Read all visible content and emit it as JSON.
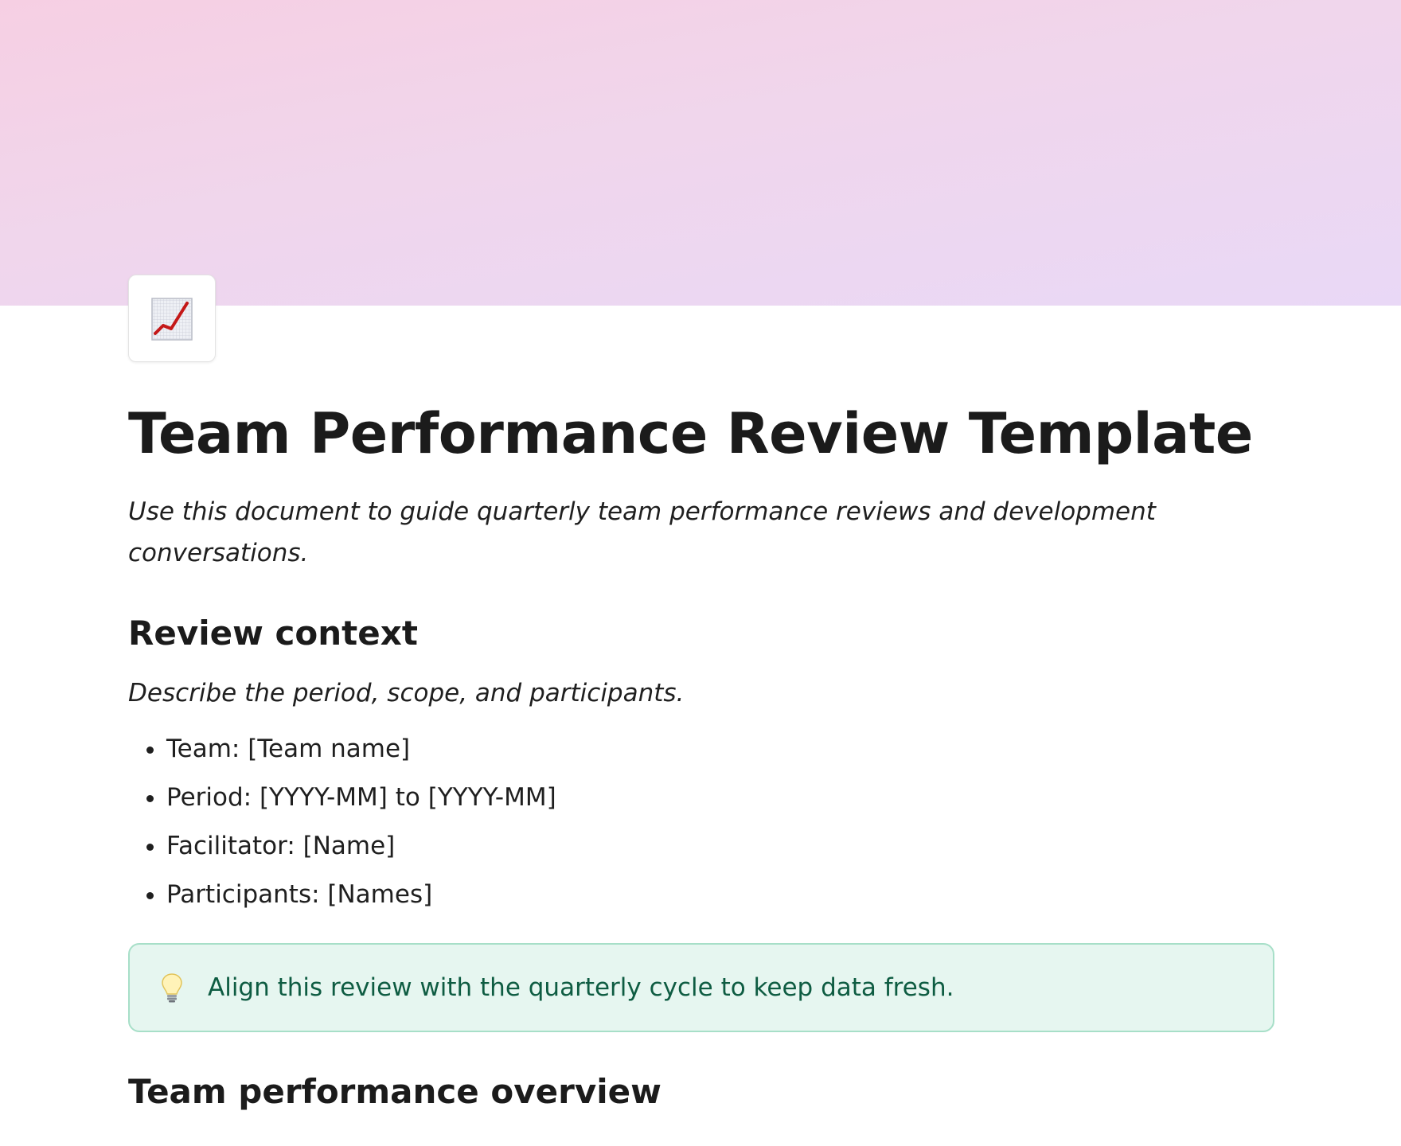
{
  "cover": {
    "gradient_colors": [
      "#f6cfe3",
      "#e9d8f6"
    ]
  },
  "page_icon": {
    "name": "chart-increasing-icon"
  },
  "document": {
    "title": "Team Performance Review Template",
    "subtitle": "Use this document to guide quarterly team performance reviews and development conversations."
  },
  "sections": {
    "review_context": {
      "heading": "Review context",
      "description": "Describe the period, scope, and participants.",
      "items": [
        "Team: [Team name]",
        "Period: [YYYY-MM] to [YYYY-MM]",
        "Facilitator: [Name]",
        "Participants: [Names]"
      ]
    },
    "callout": {
      "icon": "lightbulb-icon",
      "text": "Align this review with the quarterly cycle to keep data fresh.",
      "background": "#e6f6f0",
      "border": "#a7dfc8",
      "text_color": "#0e5c42"
    },
    "overview": {
      "heading": "Team performance overview"
    }
  }
}
